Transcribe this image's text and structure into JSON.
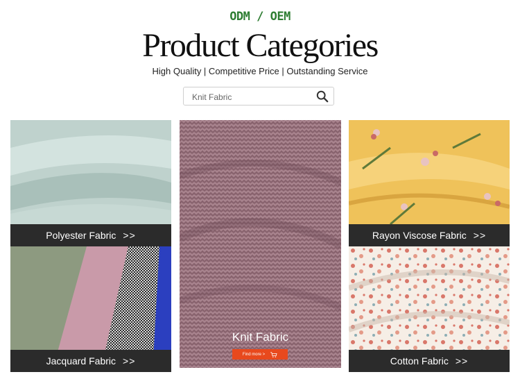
{
  "header": {
    "tagline": "ODM / OEM",
    "title": "Product Categories",
    "subtitle": "High Quality | Competitive Price | Outstanding Service"
  },
  "search": {
    "placeholder": "Knit Fabric",
    "icon": "search-icon"
  },
  "categories": [
    {
      "label": "Polyester Fabric",
      "arrows": ">>"
    },
    {
      "label": "Jacquard Fabric",
      "arrows": ">>"
    },
    {
      "label": "Knit Fabric",
      "button_label": "Find more >"
    },
    {
      "label": "Rayon Viscose Fabric",
      "arrows": ">>"
    },
    {
      "label": "Cotton Fabric",
      "arrows": ">>"
    }
  ],
  "colors": {
    "tagline": "#2e7d32",
    "label_bar": "#2b2b2b",
    "button": "#e8491d"
  }
}
